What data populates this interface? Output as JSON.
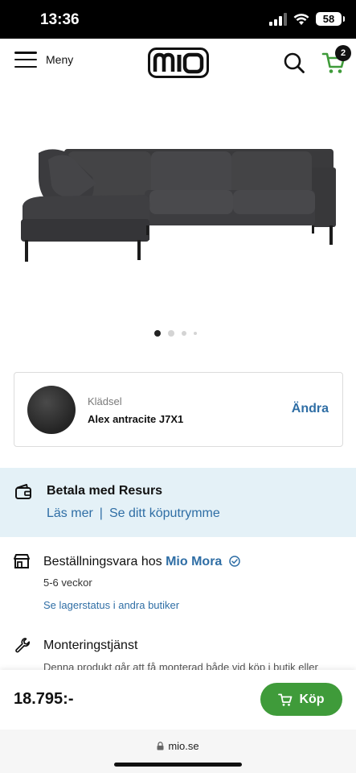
{
  "status_bar": {
    "time": "13:36",
    "battery": "58"
  },
  "header": {
    "menu_label": "Meny",
    "logo_text": "mio",
    "cart_count": "2"
  },
  "carousel": {
    "total": 4,
    "active": 0
  },
  "fabric": {
    "label": "Klädsel",
    "value": "Alex antracite J7X1",
    "change_label": "Ändra"
  },
  "resurs": {
    "title": "Betala med Resurs",
    "read_more": "Läs mer",
    "separator": "|",
    "purchase_space": "Se ditt köputrymme"
  },
  "availability": {
    "title_prefix": "Beställningsvara hos",
    "store_name": "Mio Mora",
    "delivery_time": "5-6 veckor",
    "stock_link": "Se lagerstatus i andra butiker"
  },
  "assembly": {
    "title": "Monteringstjänst",
    "text": "Denna produkt går att få monterad både vid köp i butik eller"
  },
  "buy_bar": {
    "price": "18.795:-",
    "buy_label": "Köp"
  },
  "browser": {
    "url": "mio.se"
  },
  "colors": {
    "accent_blue": "#2f6ea5",
    "buy_green": "#3f9b3a",
    "info_panel": "#e4f1f7"
  },
  "icons": [
    "menu-icon",
    "search-icon",
    "cart-icon",
    "wallet-icon",
    "store-icon",
    "verified-icon",
    "wrench-icon",
    "lock-icon"
  ]
}
